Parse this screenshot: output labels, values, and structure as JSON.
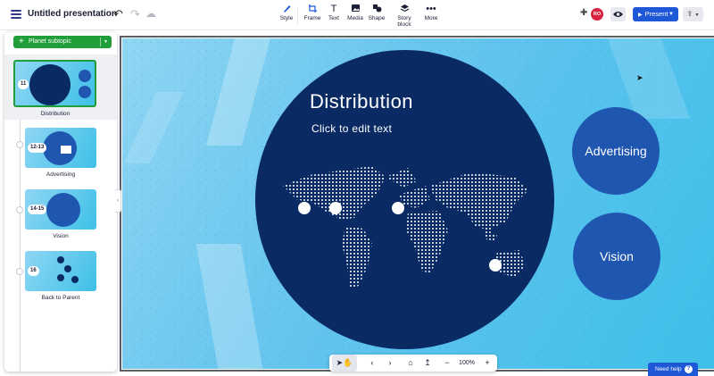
{
  "app": {
    "title": "Untitled presentation"
  },
  "toolbar": {
    "tools": [
      {
        "label": "Style",
        "icon": "style-icon"
      },
      {
        "label": "Frame",
        "icon": "frame-icon"
      },
      {
        "label": "Text",
        "icon": "text-icon"
      },
      {
        "label": "Media",
        "icon": "media-icon"
      },
      {
        "label": "Shape",
        "icon": "shape-icon"
      },
      {
        "label": "Story block",
        "icon": "story-block-icon"
      },
      {
        "label": "More",
        "icon": "more-icon"
      }
    ],
    "avatar_initials": "RO",
    "present_label": "Present"
  },
  "sidebar": {
    "add_button_label": "Planet subtopic",
    "items": [
      {
        "badge": "11",
        "label": "Distribution",
        "selected": true,
        "thumb_title": "Distribution"
      },
      {
        "badge": "12-13",
        "label": "Advertising",
        "selected": false,
        "thumb_title": "Advertising"
      },
      {
        "badge": "14-15",
        "label": "Vision",
        "selected": false,
        "thumb_title": "Vision"
      },
      {
        "badge": "16",
        "label": "Back to Parent",
        "selected": false,
        "thumb_title": ""
      }
    ],
    "mini_circles": [
      "Advertising",
      "Vision"
    ]
  },
  "canvas": {
    "title": "Distribution",
    "subtitle": "Click to edit text",
    "side_topics": [
      "Advertising",
      "Vision"
    ],
    "colors": {
      "main_circle": "#0a2a64",
      "side_circle": "#1f56b0",
      "background": "#58c2ee"
    }
  },
  "navigation": {
    "zoom": "100%"
  },
  "help": {
    "label": "Need help"
  }
}
